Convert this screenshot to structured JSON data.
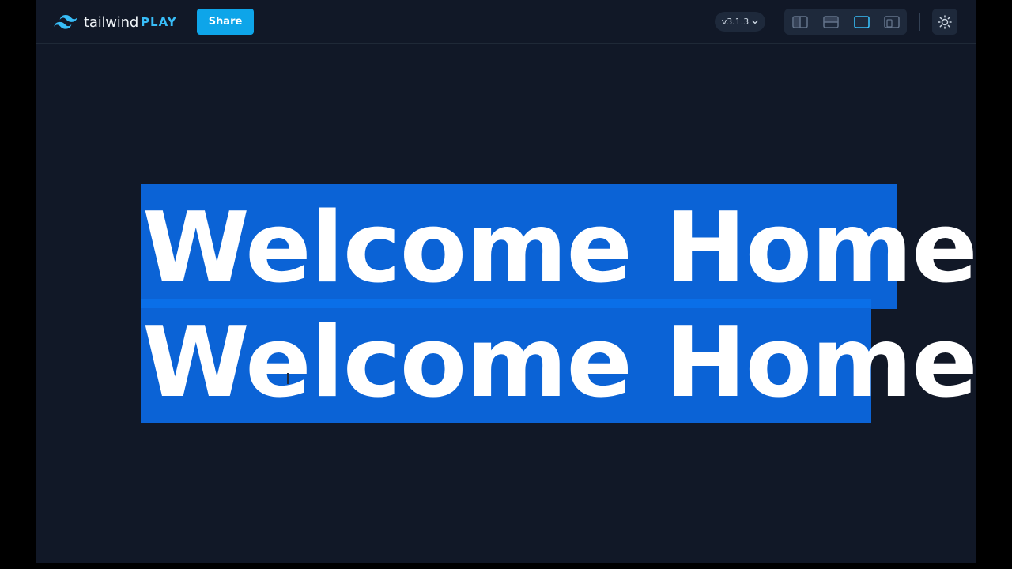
{
  "header": {
    "logo_text": "tailwind",
    "logo_suffix": "PLAY",
    "share_label": "Share",
    "version": "v3.1.3"
  },
  "layout_buttons": [
    {
      "name": "vertical-split",
      "active": false
    },
    {
      "name": "horizontal-split",
      "active": false
    },
    {
      "name": "preview-only",
      "active": true
    },
    {
      "name": "responsive",
      "active": false
    }
  ],
  "preview": {
    "headline_1": "Welcome Home",
    "headline_2": "Welcome Home"
  },
  "colors": {
    "app_bg": "#111827",
    "accent": "#0ea5e9",
    "selection": "#0b63d6",
    "active_icon": "#38bdf8",
    "inactive_icon": "#64748b"
  },
  "icons": {
    "logo": "tailwind-wave-icon",
    "version_chevron": "chevron-down-icon",
    "theme": "sun-icon"
  }
}
